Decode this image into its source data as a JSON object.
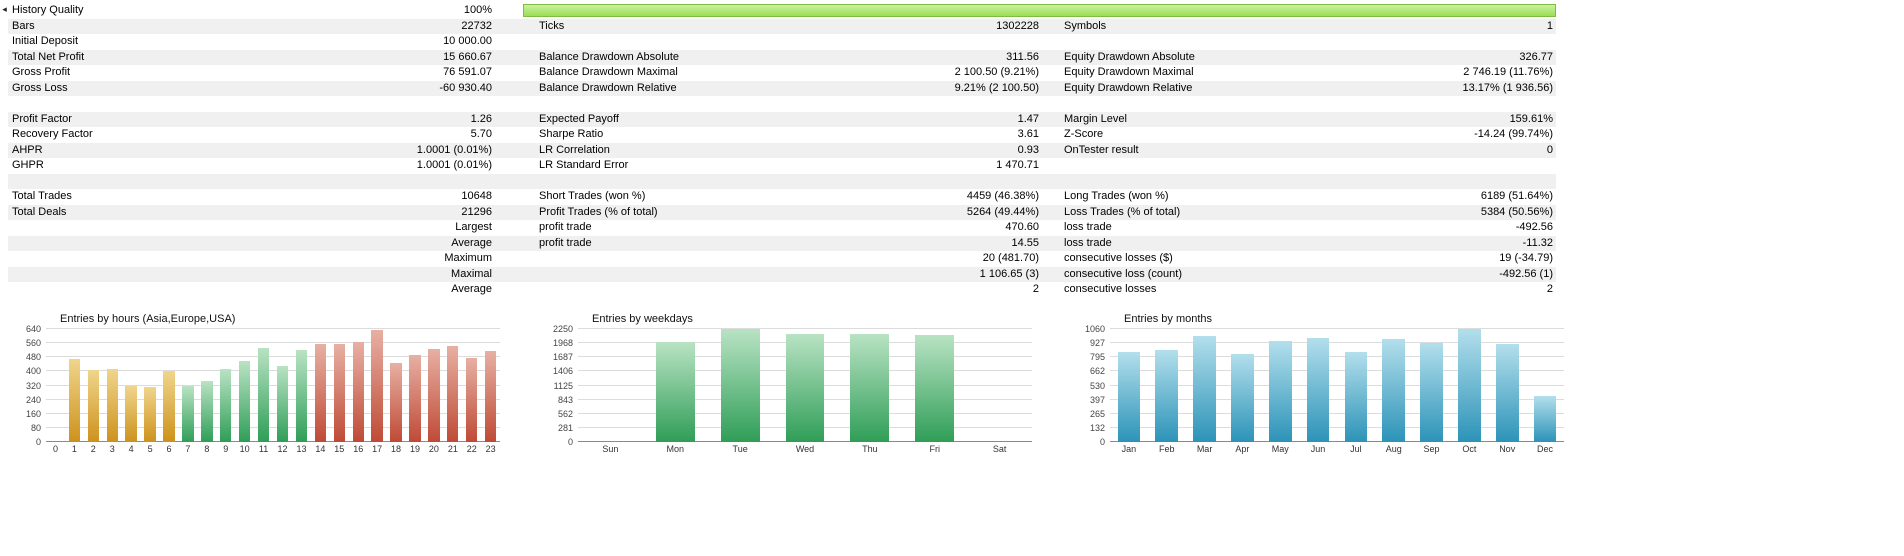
{
  "icons": {
    "collapse_arrow": "◂"
  },
  "colors": {
    "row_alt": "#f0f0f0",
    "progress_green_top": "#cdf0a0",
    "progress_green_bottom": "#9ade54"
  },
  "palette": {
    "orange": [
      "#f0d58c",
      "#cd921c"
    ],
    "green": [
      "#b9e3c4",
      "#2f9e57"
    ],
    "red": [
      "#e7b0a3",
      "#bf4a36"
    ],
    "teal": [
      "#b3dfec",
      "#2c93b8"
    ]
  },
  "table": {
    "rows": [
      {
        "progress": true,
        "cells": [
          [
            "History Quality",
            "100%"
          ],
          [
            "",
            ""
          ],
          [
            "",
            ""
          ]
        ]
      },
      {
        "cells": [
          [
            "Bars",
            "22732"
          ],
          [
            "Ticks",
            "1302228"
          ],
          [
            "Symbols",
            "1"
          ]
        ]
      },
      {
        "cells": [
          [
            "Initial Deposit",
            "10 000.00"
          ],
          [
            "",
            ""
          ],
          [
            "",
            ""
          ]
        ]
      },
      {
        "cells": [
          [
            "Total Net Profit",
            "15 660.67"
          ],
          [
            "Balance Drawdown Absolute",
            "311.56"
          ],
          [
            "Equity Drawdown Absolute",
            "326.77"
          ]
        ]
      },
      {
        "cells": [
          [
            "Gross Profit",
            "76 591.07"
          ],
          [
            "Balance Drawdown Maximal",
            "2 100.50 (9.21%)"
          ],
          [
            "Equity Drawdown Maximal",
            "2 746.19 (11.76%)"
          ]
        ]
      },
      {
        "cells": [
          [
            "Gross Loss",
            "-60 930.40"
          ],
          [
            "Balance Drawdown Relative",
            "9.21% (2 100.50)"
          ],
          [
            "Equity Drawdown Relative",
            "13.17% (1 936.56)"
          ]
        ]
      },
      {
        "cells": [
          [
            "",
            ""
          ],
          [
            "",
            ""
          ],
          [
            "",
            ""
          ]
        ]
      },
      {
        "cells": [
          [
            "Profit Factor",
            "1.26"
          ],
          [
            "Expected Payoff",
            "1.47"
          ],
          [
            "Margin Level",
            "159.61%"
          ]
        ]
      },
      {
        "cells": [
          [
            "Recovery Factor",
            "5.70"
          ],
          [
            "Sharpe Ratio",
            "3.61"
          ],
          [
            "Z-Score",
            "-14.24 (99.74%)"
          ]
        ]
      },
      {
        "cells": [
          [
            "AHPR",
            "1.0001 (0.01%)"
          ],
          [
            "LR Correlation",
            "0.93"
          ],
          [
            "OnTester result",
            "0"
          ]
        ]
      },
      {
        "cells": [
          [
            "GHPR",
            "1.0001 (0.01%)"
          ],
          [
            "LR Standard Error",
            "1 470.71"
          ],
          [
            "",
            ""
          ]
        ]
      },
      {
        "cells": [
          [
            "",
            ""
          ],
          [
            "",
            ""
          ],
          [
            "",
            ""
          ]
        ]
      },
      {
        "cells": [
          [
            "Total Trades",
            "10648"
          ],
          [
            "Short Trades (won %)",
            "4459 (46.38%)"
          ],
          [
            "Long Trades (won %)",
            "6189 (51.64%)"
          ]
        ]
      },
      {
        "cells": [
          [
            "Total Deals",
            "21296"
          ],
          [
            "Profit Trades (% of total)",
            "5264 (49.44%)"
          ],
          [
            "Loss Trades (% of total)",
            "5384 (50.56%)"
          ]
        ]
      },
      {
        "cells": [
          [
            "",
            "Largest"
          ],
          [
            "profit trade",
            "470.60"
          ],
          [
            "loss trade",
            "-492.56"
          ]
        ]
      },
      {
        "cells": [
          [
            "",
            "Average"
          ],
          [
            "profit trade",
            "14.55"
          ],
          [
            "loss trade",
            "-11.32"
          ]
        ]
      },
      {
        "cells": [
          [
            "",
            "Maximum"
          ],
          [
            "",
            "20 (481.70)"
          ],
          [
            "consecutive losses ($)",
            "19 (-34.79)"
          ]
        ]
      },
      {
        "cells": [
          [
            "",
            "Maximal"
          ],
          [
            "",
            "1 106.65 (3)"
          ],
          [
            "consecutive loss (count)",
            "-492.56 (1)"
          ]
        ]
      },
      {
        "cells": [
          [
            "",
            "Average"
          ],
          [
            "",
            "2"
          ],
          [
            "consecutive losses",
            "2"
          ]
        ]
      }
    ]
  },
  "chart_data": [
    {
      "type": "bar",
      "title": "Entries by hours (Asia,Europe,USA)",
      "xlabel": "",
      "ylabel": "",
      "categories": [
        "0",
        "1",
        "2",
        "3",
        "4",
        "5",
        "6",
        "7",
        "8",
        "9",
        "10",
        "11",
        "12",
        "13",
        "14",
        "15",
        "16",
        "17",
        "18",
        "19",
        "20",
        "21",
        "22",
        "23"
      ],
      "values": [
        0,
        470,
        410,
        415,
        320,
        310,
        400,
        315,
        345,
        415,
        460,
        535,
        430,
        520,
        555,
        555,
        565,
        635,
        445,
        490,
        525,
        545,
        475,
        515
      ],
      "bar_colors": [
        "orange",
        "orange",
        "orange",
        "orange",
        "orange",
        "orange",
        "orange",
        "green",
        "green",
        "green",
        "green",
        "green",
        "green",
        "green",
        "red",
        "red",
        "red",
        "red",
        "red",
        "red",
        "red",
        "red",
        "red",
        "red"
      ],
      "yticks": [
        0,
        80,
        160,
        240,
        320,
        400,
        480,
        560,
        640
      ],
      "ylim": [
        0,
        640
      ],
      "grid": true,
      "legend": "none"
    },
    {
      "type": "bar",
      "title": "Entries by weekdays",
      "xlabel": "",
      "ylabel": "",
      "categories": [
        "Sun",
        "Mon",
        "Tue",
        "Wed",
        "Thu",
        "Fri",
        "Sat"
      ],
      "values": [
        0,
        1985,
        2250,
        2150,
        2155,
        2135,
        0
      ],
      "bar_color": "green",
      "yticks": [
        0,
        281,
        562,
        843,
        1125,
        1406,
        1687,
        1968,
        2250
      ],
      "ylim": [
        0,
        2250
      ],
      "grid": true,
      "legend": "none"
    },
    {
      "type": "bar",
      "title": "Entries by months",
      "xlabel": "",
      "ylabel": "",
      "categories": [
        "Jan",
        "Feb",
        "Mar",
        "Apr",
        "May",
        "Jun",
        "Jul",
        "Aug",
        "Sep",
        "Oct",
        "Nov",
        "Dec"
      ],
      "values": [
        840,
        865,
        990,
        830,
        945,
        975,
        840,
        970,
        925,
        1060,
        920,
        430
      ],
      "bar_color": "teal",
      "yticks": [
        0,
        132,
        265,
        397,
        530,
        662,
        795,
        927,
        1060
      ],
      "ylim": [
        0,
        1060
      ],
      "grid": true,
      "legend": "none"
    }
  ]
}
